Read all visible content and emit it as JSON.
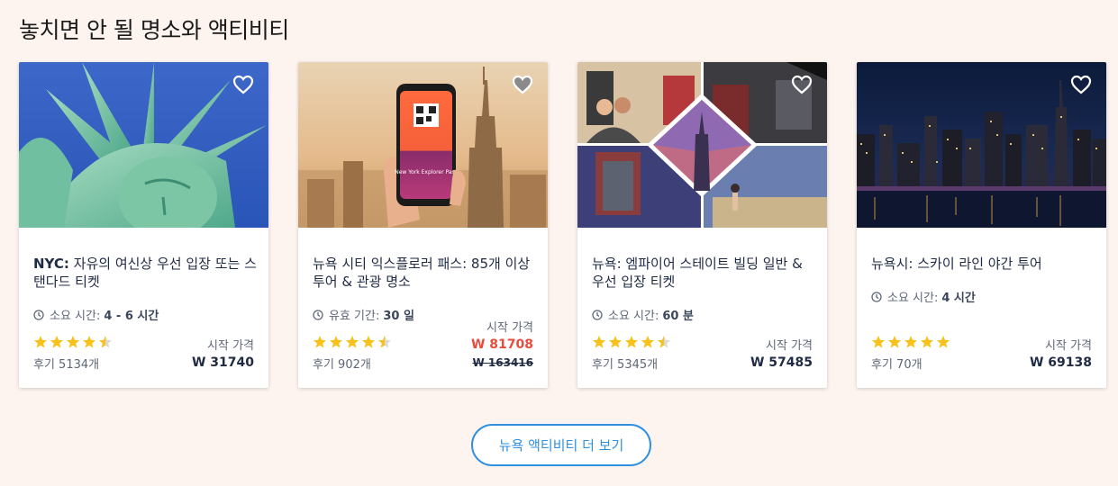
{
  "section": {
    "title": "놓치면 안 될 명소와 액티비티"
  },
  "cards": [
    {
      "title_bold": "NYC:",
      "title_rest": " 자유의 여신상 우선 입장 또는 스탠다드 티켓",
      "meta_label": "소요 시간:",
      "meta_value": "4 - 6 시간",
      "rating": 4.5,
      "reviews": "후기 5134개",
      "price_label": "시작 가격",
      "price": "W 31740"
    },
    {
      "title_bold": "",
      "title_rest": "뉴욕 시티 익스플로러 패스: 85개 이상 투어 & 관광 명소",
      "meta_label": "유효 기간:",
      "meta_value": "30 일",
      "rating": 4.5,
      "reviews": "후기 902개",
      "price_label": "시작 가격",
      "price": "W 81708",
      "old_price": "W 163416",
      "phone_text": "New York Explorer Pass"
    },
    {
      "title_bold": "",
      "title_rest": "뉴욕: 엠파이어 스테이트 빌딩 일반 & 우선 입장 티켓",
      "meta_label": "소요 시간:",
      "meta_value": "60 분",
      "rating": 4.5,
      "reviews": "후기 5345개",
      "price_label": "시작 가격",
      "price": "W 57485"
    },
    {
      "title_bold": "",
      "title_rest": "뉴욕시: 스카이 라인 야간 투어",
      "meta_label": "소요 시간:",
      "meta_value": "4 시간",
      "rating": 5,
      "reviews": "후기 70개",
      "price_label": "시작 가격",
      "price": "W 69138"
    }
  ],
  "more_button": {
    "label": "뉴욕 액티비티 더 보기"
  },
  "colors": {
    "accent": "#2f8fe0",
    "star": "#f7c21b",
    "sale": "#e84c3d",
    "background": "#fdf4ef"
  },
  "icons": [
    "heart-icon",
    "clock-icon",
    "star-icon"
  ]
}
